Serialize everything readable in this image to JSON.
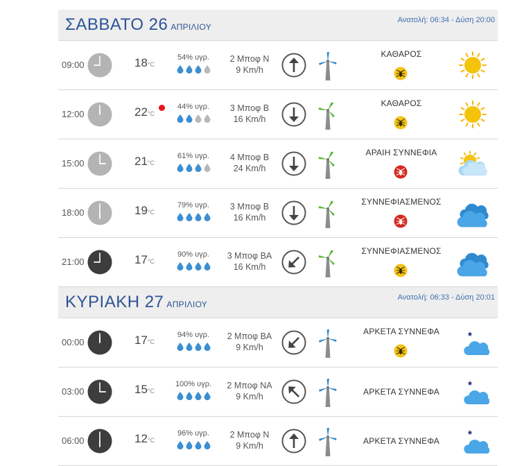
{
  "days": [
    {
      "name": "ΣΑΒΒΑΤΟ 26",
      "month": "ΑΠΡΙΛΙΟΥ",
      "sun": "Ανατολή: 06:34  - Δύση 20:00",
      "rows": [
        {
          "time": "09:00",
          "clock": "light",
          "hour": 9,
          "temp": "18",
          "unit": "°C",
          "reddot": false,
          "humidity": "54% υγρ.",
          "drops": 3,
          "wind": "2 Μποφ Ν",
          "speed": "9 Km/h",
          "dir": "N",
          "turbine": "blue",
          "condition": "ΚΑΘΑΡΟΣ",
          "bug": "yellow",
          "icon": "sun-icon"
        },
        {
          "time": "12:00",
          "clock": "light",
          "hour": 12,
          "temp": "22",
          "unit": "°C",
          "reddot": true,
          "humidity": "44% υγρ.",
          "drops": 2,
          "wind": "3 Μποφ Β",
          "speed": "16 Km/h",
          "dir": "S",
          "turbine": "green",
          "condition": "ΚΑΘΑΡΟΣ",
          "bug": "yellow",
          "icon": "sun-icon"
        },
        {
          "time": "15:00",
          "clock": "light",
          "hour": 15,
          "temp": "21",
          "unit": "°C",
          "reddot": false,
          "humidity": "61% υγρ.",
          "drops": 3,
          "wind": "4 Μποφ Β",
          "speed": "24 Km/h",
          "dir": "S",
          "turbine": "green",
          "condition": "ΑΡΑΙΗ ΣΥΝΝΕΦΙΑ",
          "bug": "red",
          "icon": "partly-cloudy-icon"
        },
        {
          "time": "18:00",
          "clock": "light",
          "hour": 18,
          "temp": "19",
          "unit": "°C",
          "reddot": false,
          "humidity": "79% υγρ.",
          "drops": 4,
          "wind": "3 Μποφ Β",
          "speed": "16 Km/h",
          "dir": "S",
          "turbine": "green",
          "condition": "ΣΥΝΝΕΦΙΑΣΜΕΝΟΣ",
          "bug": "red",
          "icon": "cloudy-icon"
        },
        {
          "time": "21:00",
          "clock": "dark",
          "hour": 21,
          "temp": "17",
          "unit": "°C",
          "reddot": false,
          "humidity": "90% υγρ.",
          "drops": 4,
          "wind": "3 Μποφ ΒΑ",
          "speed": "16 Km/h",
          "dir": "SW",
          "turbine": "green",
          "condition": "ΣΥΝΝΕΦΙΑΣΜΕΝΟΣ",
          "bug": "yellow",
          "icon": "cloudy-icon"
        }
      ]
    },
    {
      "name": "ΚΥΡΙΑΚΗ 27",
      "month": "ΑΠΡΙΛΙΟΥ",
      "sun": "Ανατολή: 06:33  - Δύση 20:01",
      "rows": [
        {
          "time": "00:00",
          "clock": "dark",
          "hour": 0,
          "temp": "17",
          "unit": "°C",
          "reddot": false,
          "humidity": "94% υγρ.",
          "drops": 4,
          "wind": "2 Μποφ ΒΑ",
          "speed": "9 Km/h",
          "dir": "SW",
          "turbine": "blue",
          "condition": "ΑΡΚΕΤΑ ΣΥΝΝΕΦΑ",
          "bug": "yellow",
          "icon": "night-cloudy-icon"
        },
        {
          "time": "03:00",
          "clock": "dark",
          "hour": 3,
          "temp": "15",
          "unit": "°C",
          "reddot": false,
          "humidity": "100% υγρ.",
          "drops": 4,
          "wind": "2 Μποφ ΝΑ",
          "speed": "9 Km/h",
          "dir": "NW",
          "turbine": "blue",
          "condition": "ΑΡΚΕΤΑ ΣΥΝΝΕΦΑ",
          "bug": "",
          "icon": "night-cloudy-icon"
        },
        {
          "time": "06:00",
          "clock": "dark",
          "hour": 6,
          "temp": "12",
          "unit": "°C",
          "reddot": false,
          "humidity": "96% υγρ.",
          "drops": 4,
          "wind": "2 Μποφ Ν",
          "speed": "9 Km/h",
          "dir": "N",
          "turbine": "blue",
          "condition": "ΑΡΚΕΤΑ ΣΥΝΝΕΦΑ",
          "bug": "",
          "icon": "night-cloudy-icon"
        }
      ]
    }
  ],
  "colors": {
    "header_text": "#2c5496",
    "drop_fill": "#3b8fd3",
    "drop_empty": "#b8b8b8",
    "turbine_blue": "#2f88c7",
    "turbine_green": "#56b632",
    "bug_yellow": "#f2c31a",
    "bug_red": "#d42a20"
  }
}
